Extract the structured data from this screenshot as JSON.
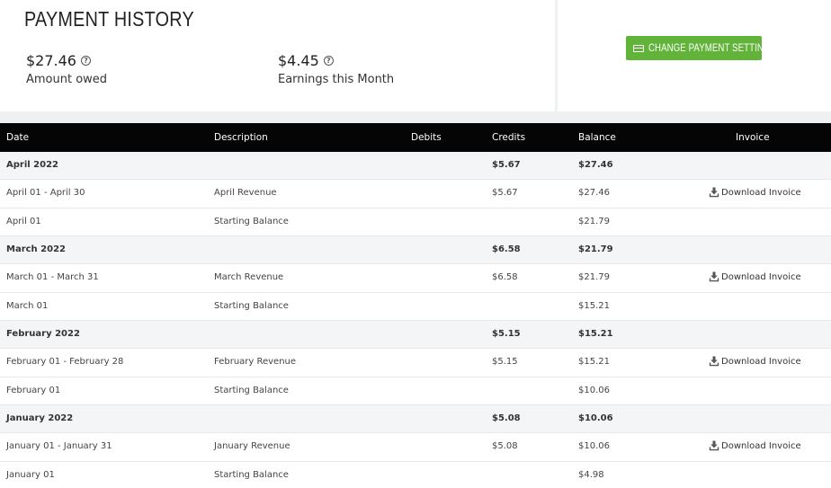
{
  "header": {
    "title": "PAYMENT HISTORY",
    "amount_owed": {
      "value": "$27.46",
      "label": "Amount owed"
    },
    "earnings": {
      "value": "$4.45",
      "label": "Earnings this Month"
    },
    "help_glyph": "?",
    "button_label": "CHANGE PAYMENT SETTINGS"
  },
  "colors": {
    "accent": "#61b33a",
    "table_header": "#050505"
  },
  "table": {
    "columns": {
      "date": "Date",
      "description": "Description",
      "debits": "Debits",
      "credits": "Credits",
      "balance": "Balance",
      "invoice": "Invoice"
    },
    "download_label": "Download Invoice",
    "rows": [
      {
        "type": "group",
        "date": "April 2022",
        "description": "",
        "credits": "$5.67",
        "balance": "$27.46",
        "invoice": false
      },
      {
        "type": "item",
        "date": "April 01 - April 30",
        "description": "April Revenue",
        "credits": "$5.67",
        "balance": "$27.46",
        "invoice": true
      },
      {
        "type": "item",
        "date": "April 01",
        "description": "Starting Balance",
        "credits": "",
        "balance": "$21.79",
        "invoice": false
      },
      {
        "type": "group",
        "date": "March 2022",
        "description": "",
        "credits": "$6.58",
        "balance": "$21.79",
        "invoice": false
      },
      {
        "type": "item",
        "date": "March 01 - March 31",
        "description": "March Revenue",
        "credits": "$6.58",
        "balance": "$21.79",
        "invoice": true
      },
      {
        "type": "item",
        "date": "March 01",
        "description": "Starting Balance",
        "credits": "",
        "balance": "$15.21",
        "invoice": false
      },
      {
        "type": "group",
        "date": "February 2022",
        "description": "",
        "credits": "$5.15",
        "balance": "$15.21",
        "invoice": false
      },
      {
        "type": "item",
        "date": "February 01 - February 28",
        "description": "February Revenue",
        "credits": "$5.15",
        "balance": "$15.21",
        "invoice": true
      },
      {
        "type": "item",
        "date": "February 01",
        "description": "Starting Balance",
        "credits": "",
        "balance": "$10.06",
        "invoice": false
      },
      {
        "type": "group",
        "date": "January 2022",
        "description": "",
        "credits": "$5.08",
        "balance": "$10.06",
        "invoice": false
      },
      {
        "type": "item",
        "date": "January 01 - January 31",
        "description": "January Revenue",
        "credits": "$5.08",
        "balance": "$10.06",
        "invoice": true
      },
      {
        "type": "item",
        "date": "January 01",
        "description": "Starting Balance",
        "credits": "",
        "balance": "$4.98",
        "invoice": false
      }
    ]
  }
}
